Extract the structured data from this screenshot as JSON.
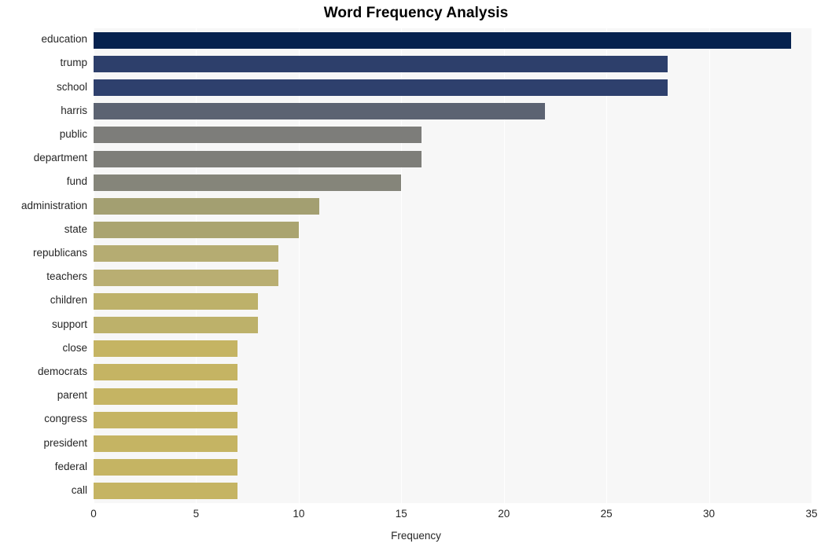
{
  "chart_data": {
    "type": "bar",
    "orientation": "horizontal",
    "title": "Word Frequency Analysis",
    "xlabel": "Frequency",
    "ylabel": "",
    "categories": [
      "education",
      "trump",
      "school",
      "harris",
      "public",
      "department",
      "fund",
      "administration",
      "state",
      "republicans",
      "teachers",
      "children",
      "support",
      "close",
      "democrats",
      "parent",
      "congress",
      "president",
      "federal",
      "call"
    ],
    "values": [
      34,
      28,
      28,
      22,
      16,
      16,
      15,
      11,
      10,
      9,
      9,
      8,
      8,
      7,
      7,
      7,
      7,
      7,
      7,
      7
    ],
    "bar_colors": [
      "#06224f",
      "#2d3f6b",
      "#2e406d",
      "#5c6372",
      "#7d7d7a",
      "#7e7e79",
      "#85857a",
      "#a39f71",
      "#aaa470",
      "#b5ac72",
      "#b9ae72",
      "#bdb16a",
      "#bdb16a",
      "#c5b463",
      "#c5b463",
      "#c5b463",
      "#c5b463",
      "#c5b463",
      "#c5b463",
      "#c5b463"
    ],
    "xlim": [
      0,
      35
    ],
    "xticks": [
      0,
      5,
      10,
      15,
      20,
      25,
      30,
      35
    ],
    "xtick_labels": [
      "0",
      "5",
      "10",
      "15",
      "20",
      "25",
      "30",
      "35"
    ],
    "grid": true,
    "grid_axis": "x",
    "legend": false,
    "plot_background": "#f7f7f7",
    "figure_background": "#ffffff",
    "gridline_color": "#ffffff",
    "tick_label_color": "#262626",
    "title_color": "#000000"
  }
}
